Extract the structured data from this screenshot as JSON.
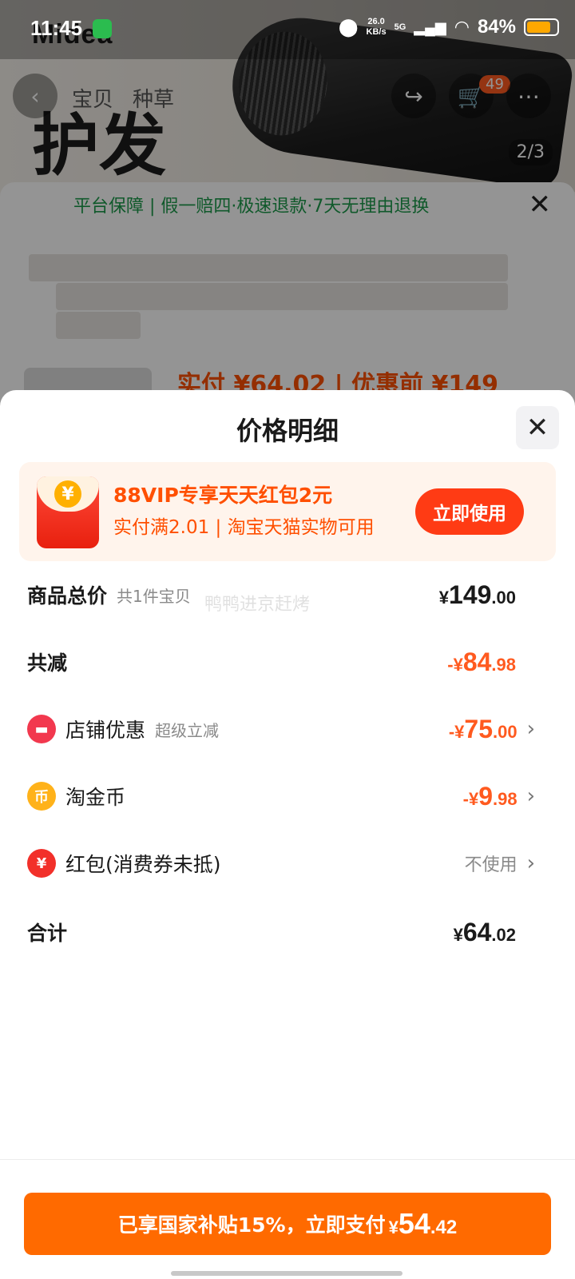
{
  "status_bar": {
    "time": "11:45",
    "net_speed_value": "26.0",
    "net_speed_unit": "KB/s",
    "signal_label": "5G",
    "battery": "84%"
  },
  "background": {
    "brand": "Midea",
    "hero_text": "护发",
    "tabs": [
      "宝贝",
      "种草"
    ],
    "cart_badge": "49",
    "pager": "2/3",
    "guarantee": "平台保障 | 假一赔四·极速退款·7天无理由退换",
    "mini_price": "实付 ¥64.02 | 优惠前 ¥149"
  },
  "sheet": {
    "title": "价格明细",
    "promo": {
      "title": "88VIP专享天天红包2元",
      "subtitle": "实付满2.01 | 淘宝天猫实物可用",
      "button": "立即使用"
    },
    "rows": [
      {
        "label": "商品总价",
        "sub": "共1件宝贝",
        "sym": "¥",
        "int": "149",
        "dec": ".00"
      },
      {
        "label": "共减",
        "sym": "-¥",
        "int": "84",
        "dec": ".98"
      },
      {
        "label": "店铺优惠",
        "sub": "超级立减",
        "sym": "-¥",
        "int": "75",
        "dec": ".00"
      },
      {
        "label": "淘金币",
        "sym": "-¥",
        "int": "9",
        "dec": ".98"
      },
      {
        "label": "红包(消费券未抵)",
        "value": "不使用"
      },
      {
        "label": "合计",
        "sym": "¥",
        "int": "64",
        "dec": ".02"
      }
    ],
    "watermark": "鸭鸭进京赶烤"
  },
  "pay_button": {
    "text": "已享国家补贴15%，立即支付",
    "sym": "¥",
    "int": "54",
    "dec": ".42"
  },
  "colors": {
    "accent_orange": "#ff6a00",
    "discount_orange": "#ff5a1f",
    "promo_red": "#ff3b14"
  }
}
